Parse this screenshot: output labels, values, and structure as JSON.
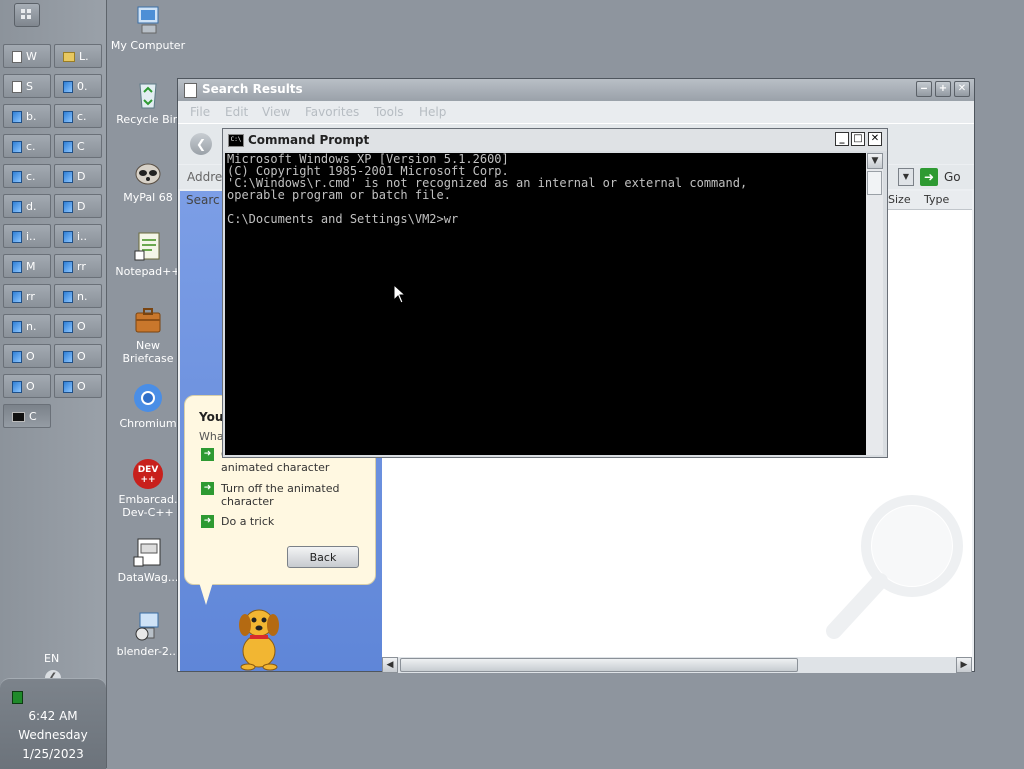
{
  "taskbar": {
    "buttons": [
      {
        "label": "W",
        "icon": "notepad-icon"
      },
      {
        "label": "L.",
        "icon": "folder-icon"
      },
      {
        "label": "S",
        "icon": "text-file-icon"
      },
      {
        "label": "0.",
        "icon": "document-icon"
      },
      {
        "label": "b.",
        "icon": "document-icon"
      },
      {
        "label": "c.",
        "icon": "document-icon"
      },
      {
        "label": "c.",
        "icon": "document-icon"
      },
      {
        "label": "C",
        "icon": "document-icon"
      },
      {
        "label": "c.",
        "icon": "document-icon"
      },
      {
        "label": "D",
        "icon": "document-icon"
      },
      {
        "label": "d.",
        "icon": "document-icon"
      },
      {
        "label": "D",
        "icon": "document-icon"
      },
      {
        "label": "i..",
        "icon": "document-icon"
      },
      {
        "label": "i..",
        "icon": "document-icon"
      },
      {
        "label": "M",
        "icon": "document-icon"
      },
      {
        "label": "rr",
        "icon": "document-icon"
      },
      {
        "label": "rr",
        "icon": "document-icon"
      },
      {
        "label": "n.",
        "icon": "document-icon"
      },
      {
        "label": "n.",
        "icon": "document-icon"
      },
      {
        "label": "O",
        "icon": "document-icon"
      },
      {
        "label": "O",
        "icon": "document-icon"
      },
      {
        "label": "O",
        "icon": "document-icon"
      },
      {
        "label": "O",
        "icon": "document-icon"
      },
      {
        "label": "O",
        "icon": "document-icon"
      },
      {
        "label": "C",
        "icon": "cmd-icon",
        "active": true
      }
    ],
    "language": "EN",
    "clock": {
      "time": "6:42 AM",
      "day": "Wednesday",
      "date": "1/25/2023"
    }
  },
  "desktop_icons": [
    {
      "label": "My Computer",
      "icon": "computer-icon"
    },
    {
      "label": "Recycle Bin",
      "icon": "recycle-bin-icon"
    },
    {
      "label": "MyPal 68",
      "icon": "mypal-icon"
    },
    {
      "label": "Notepad++",
      "icon": "notepadpp-icon"
    },
    {
      "label": "New Briefcase",
      "icon": "briefcase-icon"
    },
    {
      "label": "Chromium",
      "icon": "chromium-icon"
    },
    {
      "label": "Embarcad. Dev-C++",
      "icon": "devcpp-icon"
    },
    {
      "label": "DataWag...",
      "icon": "datawag-icon"
    },
    {
      "label": "blender-2...",
      "icon": "blender-icon"
    }
  ],
  "explorer": {
    "title": "Search Results",
    "menu": [
      "File",
      "Edit",
      "View",
      "Favorites",
      "Tools",
      "Help"
    ],
    "address_label": "Addre",
    "go_label": "Go",
    "search_label": "Searc",
    "columns": [
      "Size",
      "Type"
    ],
    "assistant": {
      "heading": "You",
      "prompt": "What",
      "options": [
        "Choose a different animated character",
        "Turn off the animated character",
        "Do a trick"
      ],
      "back_label": "Back"
    }
  },
  "cmd": {
    "title": "Command Prompt",
    "lines": [
      "Microsoft Windows XP [Version 5.1.2600]",
      "(C) Copyright 1985-2001 Microsoft Corp.",
      "'C:\\Windows\\r.cmd' is not recognized as an internal or external command,",
      "operable program or batch file.",
      "",
      "C:\\Documents and Settings\\VM2>wr"
    ]
  }
}
